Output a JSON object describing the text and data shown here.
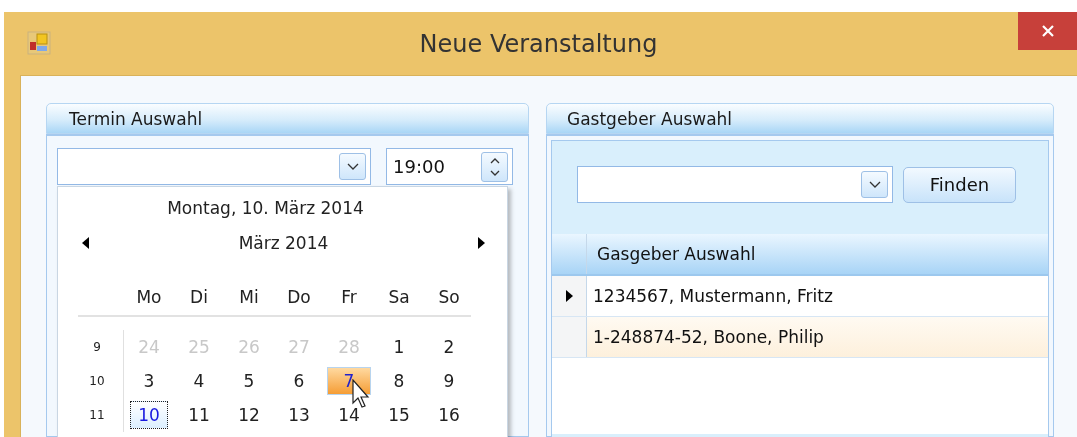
{
  "window": {
    "title": "Neue Veranstaltung"
  },
  "termin_panel": {
    "title": "Termin Auswahl",
    "time_field": {
      "value": "19:00"
    },
    "calendar": {
      "long_date": "Montag, 10. März 2014",
      "month_title": "März 2014",
      "weekdays": [
        "Mo",
        "Di",
        "Mi",
        "Do",
        "Fr",
        "Sa",
        "So"
      ],
      "weeks": [
        {
          "number": "9",
          "days": [
            {
              "label": "24",
              "muted": true,
              "today": false,
              "hovered": false
            },
            {
              "label": "25",
              "muted": true,
              "today": false,
              "hovered": false
            },
            {
              "label": "26",
              "muted": true,
              "today": false,
              "hovered": false
            },
            {
              "label": "27",
              "muted": true,
              "today": false,
              "hovered": false
            },
            {
              "label": "28",
              "muted": true,
              "today": false,
              "hovered": false
            },
            {
              "label": "1",
              "muted": false,
              "today": false,
              "hovered": false
            },
            {
              "label": "2",
              "muted": false,
              "today": false,
              "hovered": false
            }
          ]
        },
        {
          "number": "10",
          "days": [
            {
              "label": "3",
              "muted": false,
              "today": false,
              "hovered": false
            },
            {
              "label": "4",
              "muted": false,
              "today": false,
              "hovered": false
            },
            {
              "label": "5",
              "muted": false,
              "today": false,
              "hovered": false
            },
            {
              "label": "6",
              "muted": false,
              "today": false,
              "hovered": false
            },
            {
              "label": "7",
              "muted": false,
              "today": false,
              "hovered": true
            },
            {
              "label": "8",
              "muted": false,
              "today": false,
              "hovered": false
            },
            {
              "label": "9",
              "muted": false,
              "today": false,
              "hovered": false
            }
          ]
        },
        {
          "number": "11",
          "days": [
            {
              "label": "10",
              "muted": false,
              "today": true,
              "hovered": false
            },
            {
              "label": "11",
              "muted": false,
              "today": false,
              "hovered": false
            },
            {
              "label": "12",
              "muted": false,
              "today": false,
              "hovered": false
            },
            {
              "label": "13",
              "muted": false,
              "today": false,
              "hovered": false
            },
            {
              "label": "14",
              "muted": false,
              "today": false,
              "hovered": false
            },
            {
              "label": "15",
              "muted": false,
              "today": false,
              "hovered": false
            },
            {
              "label": "16",
              "muted": false,
              "today": false,
              "hovered": false
            }
          ]
        }
      ]
    }
  },
  "gastgeber_panel": {
    "title": "Gastgeber Auswahl",
    "find_button": "Finden",
    "table": {
      "columns": [
        "Gasgeber Auswahl"
      ],
      "rows": [
        {
          "cells": [
            "1234567, Mustermann, Fritz"
          ],
          "selected": true,
          "hovered": false
        },
        {
          "cells": [
            "1-248874-52, Boone, Philip"
          ],
          "selected": false,
          "hovered": true
        }
      ]
    }
  }
}
